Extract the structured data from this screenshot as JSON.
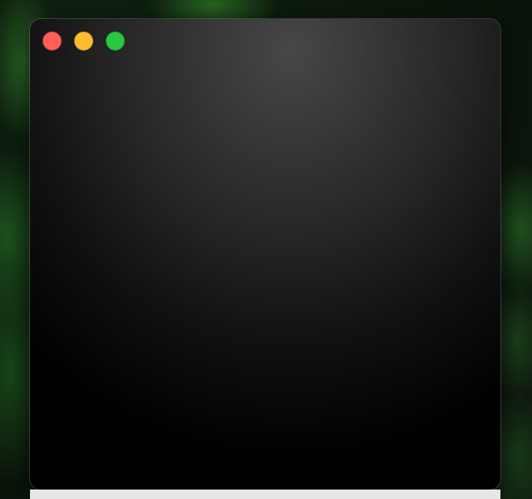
{
  "window": {
    "controls": [
      {
        "name": "close",
        "color": "#ff5f57"
      },
      {
        "name": "minimize",
        "color": "#febc2e"
      },
      {
        "name": "maximize",
        "color": "#28c840"
      }
    ]
  }
}
